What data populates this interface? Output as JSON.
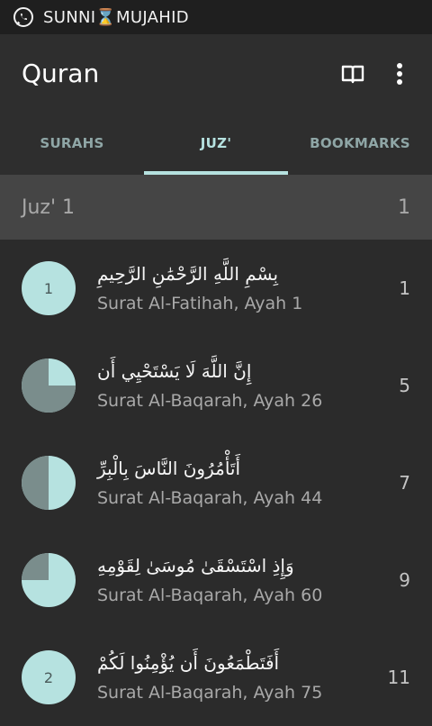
{
  "status": {
    "text": "SUNNI⌛MUJAHID"
  },
  "appbar": {
    "title": "Quran"
  },
  "tabs": [
    {
      "label": "SURAHS",
      "active": false
    },
    {
      "label": "JUZ'",
      "active": true
    },
    {
      "label": "BOOKMARKS",
      "active": false
    }
  ],
  "section": {
    "label": "Juz' 1",
    "page": "1"
  },
  "rows": [
    {
      "marker_type": "number",
      "marker_label": "1",
      "arabic": "بِسْمِ اللَّهِ الرَّحْمَٰنِ الرَّحِيمِ",
      "sub": "Surat Al-Fatihah, Ayah 1",
      "page": "1"
    },
    {
      "marker_type": "quarter",
      "fill_fraction": 0.25,
      "arabic": "إِنَّ اللَّهَ لَا يَسْتَحْيِي أَن",
      "sub": "Surat Al-Baqarah, Ayah 26",
      "page": "5"
    },
    {
      "marker_type": "quarter",
      "fill_fraction": 0.5,
      "arabic": "أَتَأْمُرُونَ النَّاسَ بِالْبِرِّ",
      "sub": "Surat Al-Baqarah, Ayah 44",
      "page": "7"
    },
    {
      "marker_type": "quarter",
      "fill_fraction": 0.75,
      "arabic": "وَإِذِ اسْتَسْقَىٰ مُوسَىٰ لِقَوْمِهِ",
      "sub": "Surat Al-Baqarah, Ayah 60",
      "page": "9"
    },
    {
      "marker_type": "number",
      "marker_label": "2",
      "arabic": "أَفَتَطْمَعُونَ أَن يُؤْمِنُوا لَكُمْ",
      "sub": "Surat Al-Baqarah, Ayah 75",
      "page": "11"
    }
  ],
  "colors": {
    "accent": "#b6e2e0",
    "marker_dark": "#7a8d8c"
  },
  "icons": {
    "status": "whatsapp-icon",
    "read": "open-book-icon",
    "menu": "overflow-menu-icon"
  }
}
